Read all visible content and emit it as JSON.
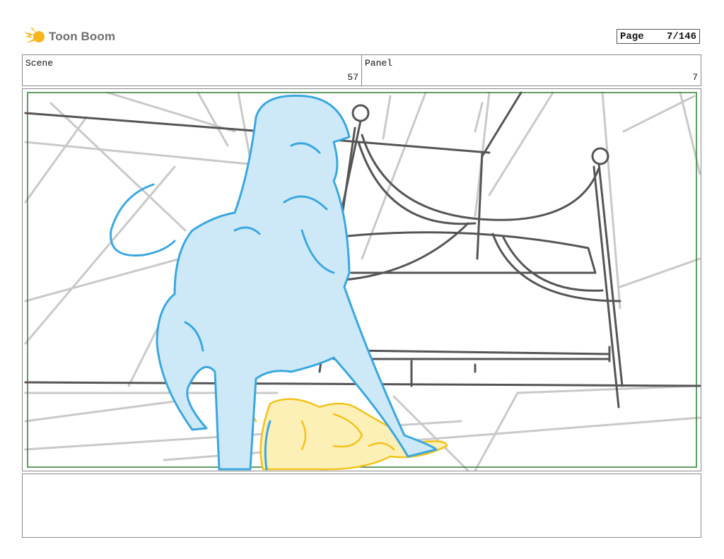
{
  "header": {
    "logo_text": "Toon Boom",
    "page_label": "Page",
    "page_value": "7/146"
  },
  "info": {
    "scene_label": "Scene",
    "scene_value": "57",
    "panel_label": "Panel",
    "panel_value": "7"
  },
  "colors": {
    "blue_line": "#3aa7df",
    "blue_fill": "#cde9f8",
    "yellow_line": "#f2c21a",
    "yellow_fill": "#fdf0b6",
    "frame_green": "#2e7d32",
    "sketch_gray": "#555555",
    "guide_gray": "#c9c9c9"
  },
  "notes": {
    "text": ""
  }
}
